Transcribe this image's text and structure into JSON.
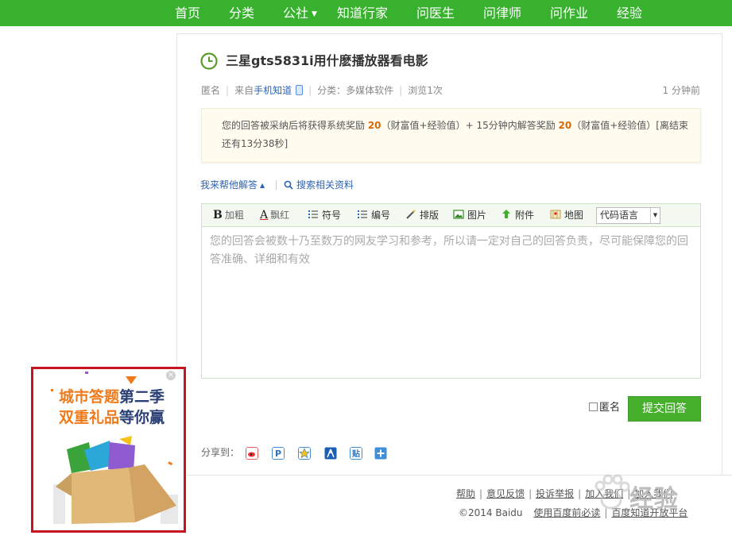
{
  "nav": {
    "items": [
      {
        "label": "首页"
      },
      {
        "label": "分类"
      },
      {
        "label": "公社"
      },
      {
        "label": "知道行家"
      },
      {
        "label": "问医生"
      },
      {
        "label": "问律师"
      },
      {
        "label": "问作业"
      },
      {
        "label": "经验"
      }
    ],
    "bg_color": "#38b12e"
  },
  "question": {
    "title": "三星gts5831i用什麽播放器看电影",
    "author": "匿名",
    "source_prefix": "来自",
    "source": "手机知道",
    "category": "分类：多媒体软件",
    "views": "浏览1次",
    "time": "1 分钟前"
  },
  "reward": {
    "text1": "您的回答被采纳后将获得系统奖励 ",
    "num1": "20",
    "text2": "（财富值+经验值）+ 15分钟内解答奖励 ",
    "num2": "20",
    "text3": "（财富值+经验值）[离结束还有13分38秒]"
  },
  "answer": {
    "toggle_label": "我来帮他解答",
    "search_label": "搜索相关资料",
    "placeholder": "您的回答会被数十乃至数万的网友学习和参考，所以请一定对自己的回答负责，尽可能保障您的回答准确、详细和有效",
    "anon_label": "匿名",
    "submit_label": "提交回答"
  },
  "toolbar": {
    "bold": "加粗",
    "color": "飘红",
    "symbol": "符号",
    "numbering": "编号",
    "layout": "排版",
    "image": "图片",
    "attachment": "附件",
    "map": "地图",
    "code_lang": "代码语言"
  },
  "share": {
    "label": "分享到："
  },
  "footer": {
    "links_row1": [
      "帮助",
      "意见反馈",
      "投诉举报",
      "加入我们",
      "加入我们"
    ],
    "copyright": "©2014 Baidu",
    "link_terms": "使用百度前必读",
    "link_platform": "百度知道开放平台"
  },
  "watermark": {
    "text": "经验"
  },
  "ad": {
    "line1_a": "城市答题",
    "line1_b": "第二季",
    "line2_a": "双重礼品",
    "line2_b": "等你赢",
    "close": "×"
  },
  "colors": {
    "accent_green": "#46b02d",
    "link_blue": "#2d64b3",
    "reward_orange": "#d46c0a",
    "ad_border": "#c8141e"
  }
}
